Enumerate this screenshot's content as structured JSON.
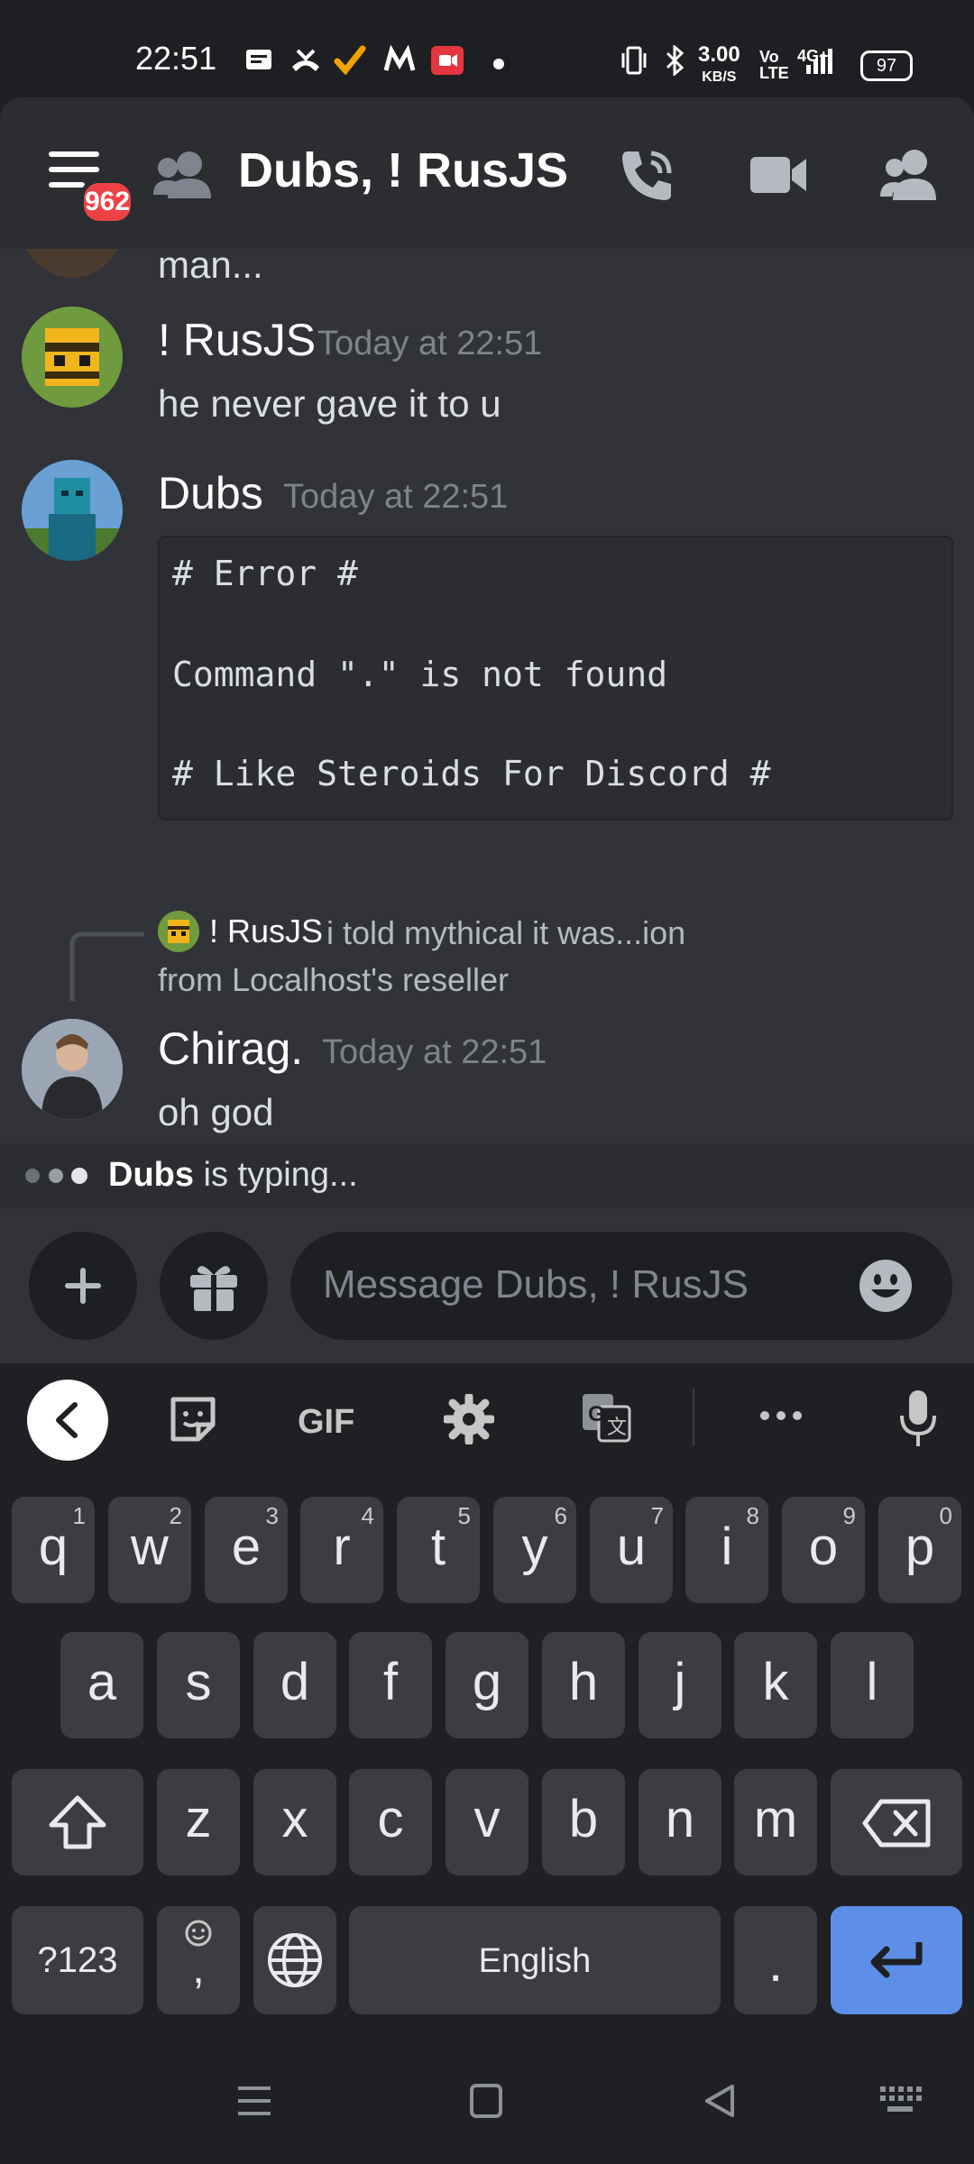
{
  "status_bar": {
    "time": "22:51",
    "speed_value": "3.00",
    "speed_unit": "KB/S",
    "battery": "97",
    "network": "4G+"
  },
  "header": {
    "title": "Dubs, ! RusJS",
    "badge_count": "962"
  },
  "chat": {
    "partial_message": "man...",
    "messages": [
      {
        "author": "! RusJS",
        "timestamp": "Today at 22:51",
        "text": "he never gave it to u"
      },
      {
        "author": "Dubs",
        "timestamp": "Today at 22:51",
        "code_lines": [
          "# Error #",
          "",
          "Command \".\" is not found",
          "",
          "# Like Steroids For Discord #"
        ]
      },
      {
        "reply": {
          "author": "! RusJS",
          "text_line1": "i told mythical it was...ion",
          "text_line2": "from Localhost's reseller"
        },
        "author": "Chirag.",
        "timestamp": "Today at 22:51",
        "text": "oh god"
      }
    ],
    "typing": {
      "user": "Dubs",
      "suffix": " is typing..."
    }
  },
  "composer": {
    "placeholder": "Message Dubs, ! RusJS"
  },
  "keyboard": {
    "toolbar": [
      "back-icon",
      "sticker-icon",
      "GIF",
      "settings-icon",
      "translate-icon",
      "more-icon",
      "mic-icon"
    ],
    "row1": [
      {
        "k": "q",
        "s": "1"
      },
      {
        "k": "w",
        "s": "2"
      },
      {
        "k": "e",
        "s": "3"
      },
      {
        "k": "r",
        "s": "4"
      },
      {
        "k": "t",
        "s": "5"
      },
      {
        "k": "y",
        "s": "6"
      },
      {
        "k": "u",
        "s": "7"
      },
      {
        "k": "i",
        "s": "8"
      },
      {
        "k": "o",
        "s": "9"
      },
      {
        "k": "p",
        "s": "0"
      }
    ],
    "row2": [
      "a",
      "s",
      "d",
      "f",
      "g",
      "h",
      "j",
      "k",
      "l"
    ],
    "row3": [
      "z",
      "x",
      "c",
      "v",
      "b",
      "n",
      "m"
    ],
    "symbols_label": "?123",
    "comma": ",",
    "space_label": "English",
    "period": "."
  },
  "colors": {
    "accent": "#5e8fe8",
    "badge": "#ed4245"
  }
}
